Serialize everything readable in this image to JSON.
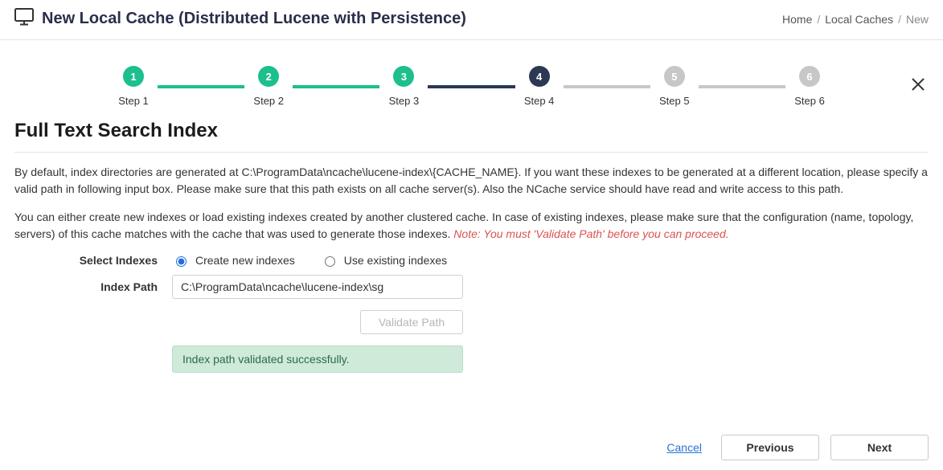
{
  "header": {
    "title": "New Local Cache (Distributed Lucene with Persistence)"
  },
  "breadcrumb": {
    "home": "Home",
    "local_caches": "Local Caches",
    "current": "New"
  },
  "stepper": {
    "steps": [
      {
        "num": "1",
        "label": "Step 1",
        "state": "done"
      },
      {
        "num": "2",
        "label": "Step 2",
        "state": "done"
      },
      {
        "num": "3",
        "label": "Step 3",
        "state": "done"
      },
      {
        "num": "4",
        "label": "Step 4",
        "state": "active"
      },
      {
        "num": "5",
        "label": "Step 5",
        "state": "pending"
      },
      {
        "num": "6",
        "label": "Step 6",
        "state": "pending"
      }
    ]
  },
  "section": {
    "title": "Full Text Search Index",
    "desc1": "By default, index directories are generated at C:\\ProgramData\\ncache\\lucene-index\\{CACHE_NAME}. If you want these indexes to be generated at a different location, please specify a valid path in following input box. Please make sure that this path exists on all cache server(s). Also the NCache service should have read and write access to this path.",
    "desc2_prefix": "You can either create new indexes or load existing indexes created by another clustered cache. In case of existing indexes, please make sure that the configuration (name, topology, servers) of this cache matches with the cache that was used to generate those indexes. ",
    "desc2_note": "Note: You must 'Validate Path' before you can proceed."
  },
  "form": {
    "select_indexes_label": "Select Indexes",
    "create_label": "Create new indexes",
    "use_label": "Use existing indexes",
    "selected_option": "create",
    "index_path_label": "Index Path",
    "index_path_value": "C:\\ProgramData\\ncache\\lucene-index\\sg",
    "validate_button": "Validate Path",
    "success_message": "Index path validated successfully."
  },
  "footer": {
    "cancel": "Cancel",
    "previous": "Previous",
    "next": "Next"
  }
}
